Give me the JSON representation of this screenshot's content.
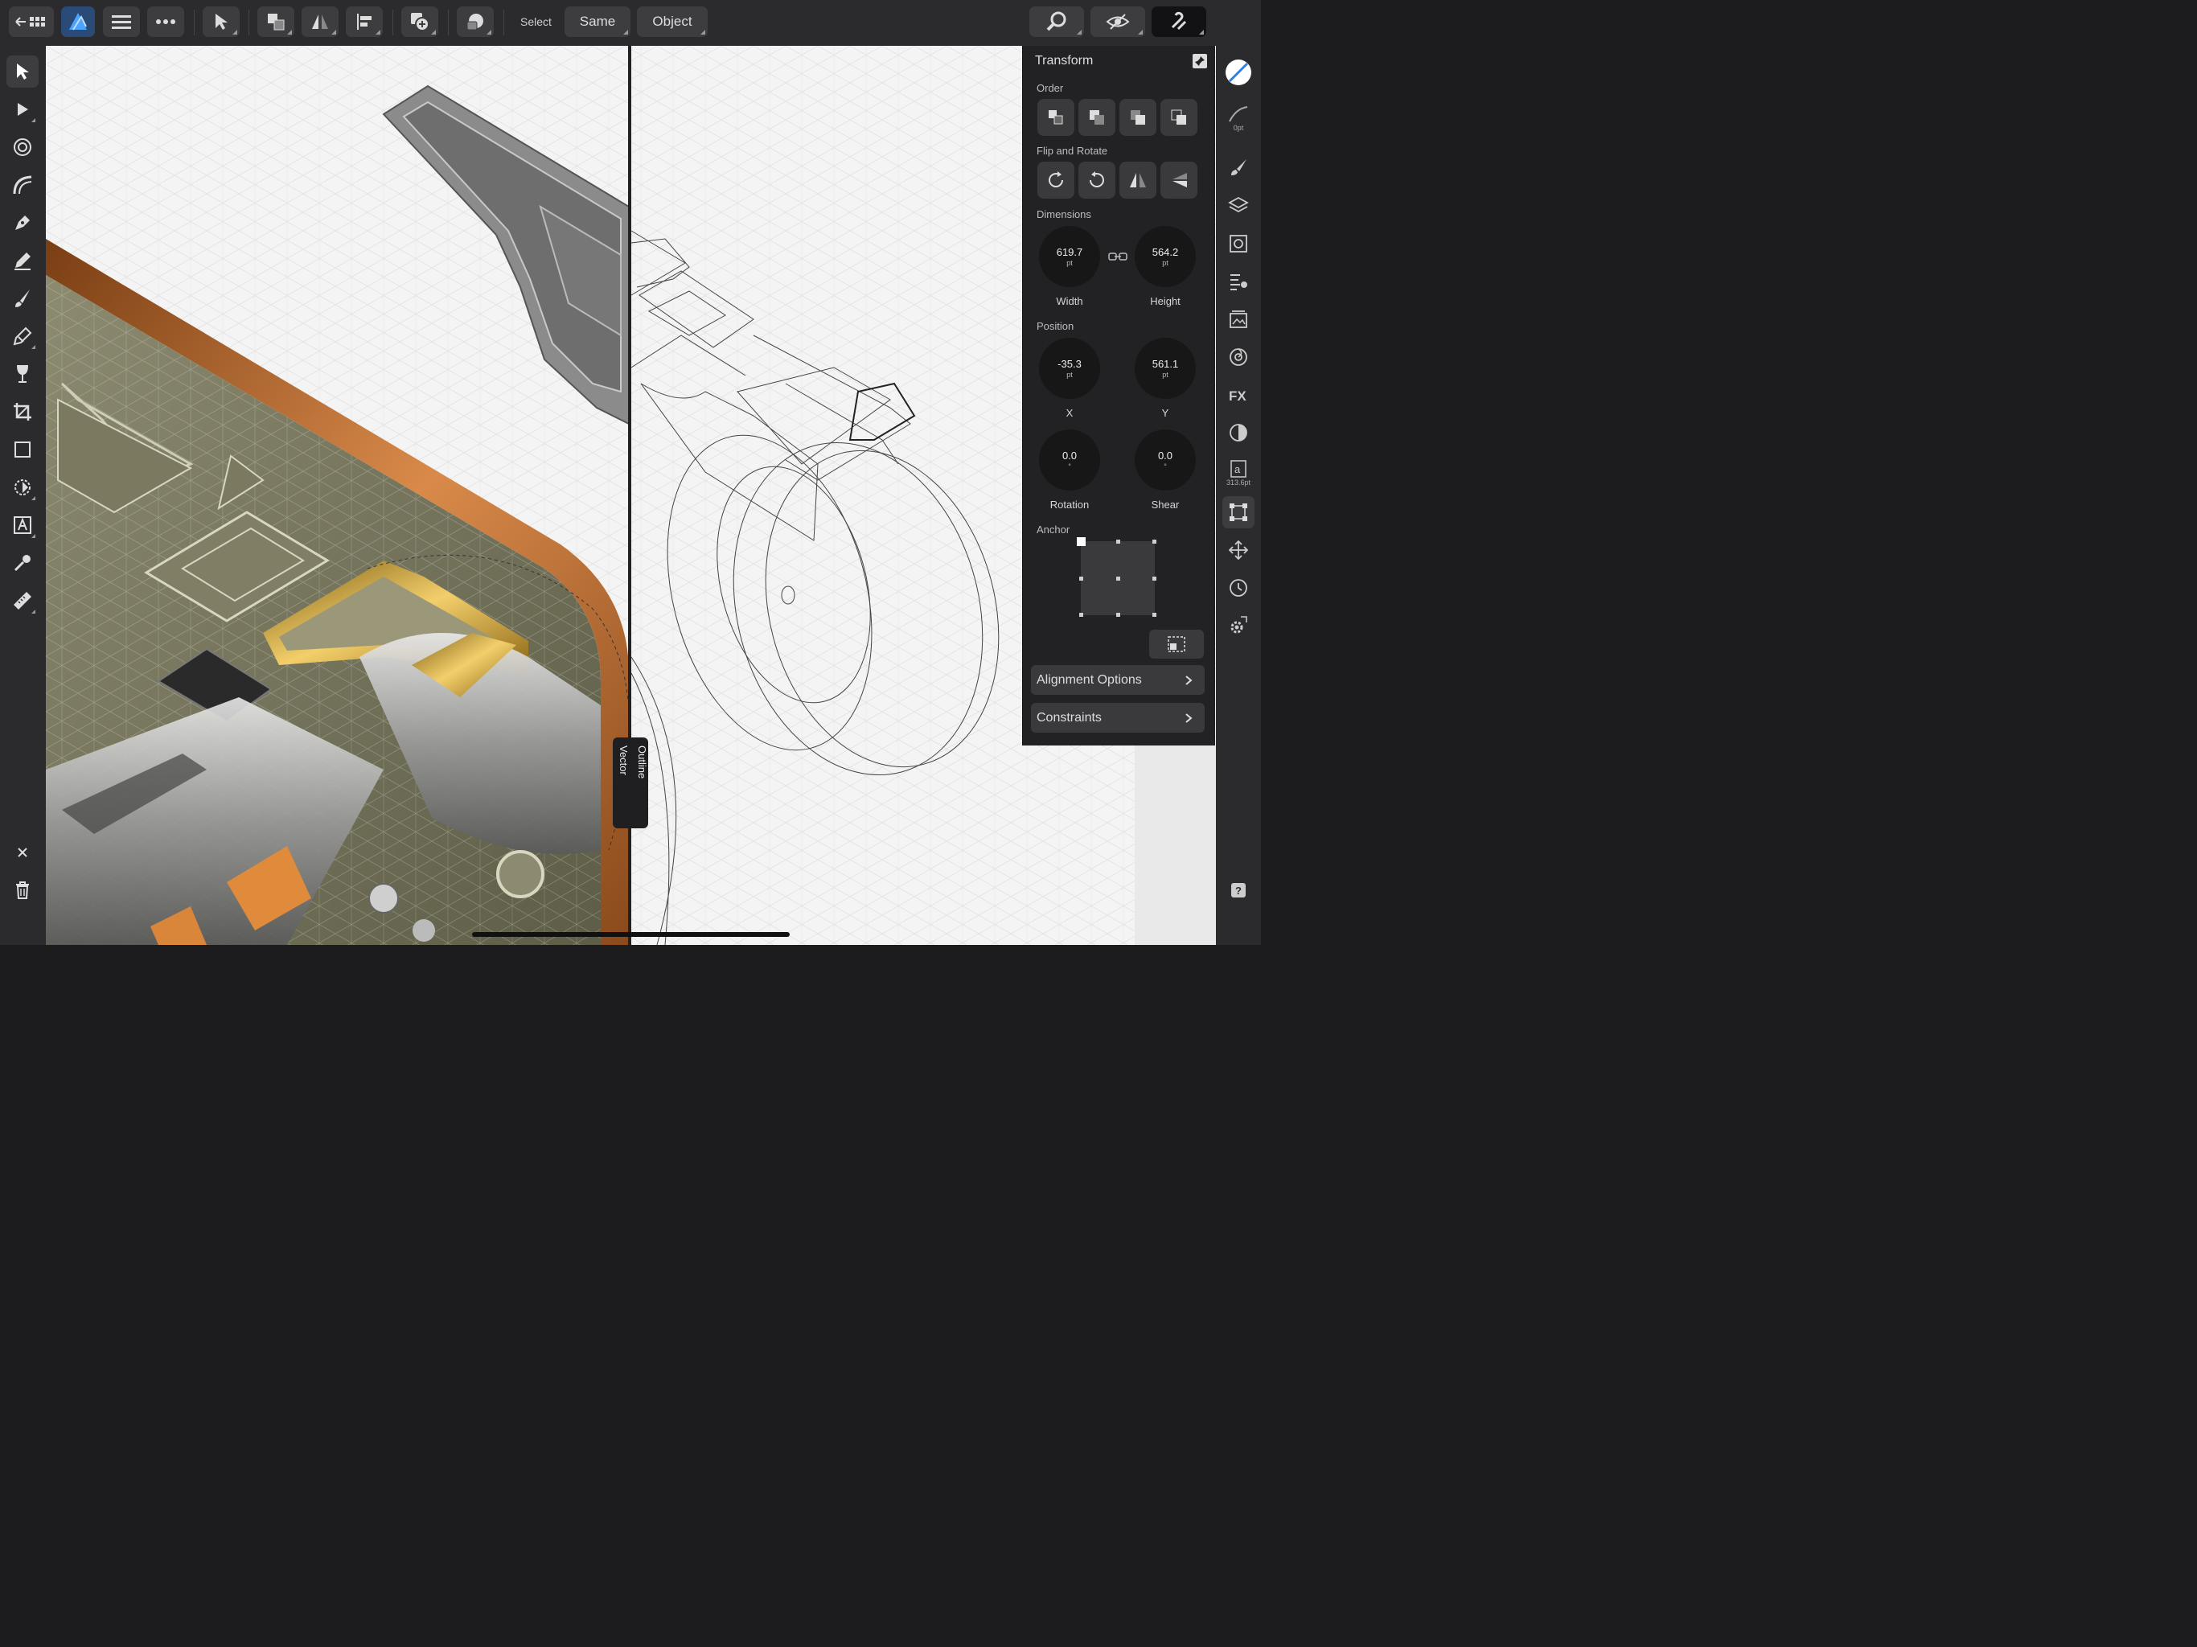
{
  "toolbar": {
    "select_label": "Select",
    "same_label": "Same",
    "object_label": "Object"
  },
  "transform": {
    "title": "Transform",
    "order_label": "Order",
    "flip_rotate_label": "Flip and Rotate",
    "dimensions_label": "Dimensions",
    "width_value": "619.7",
    "width_unit": "pt",
    "width_label": "Width",
    "height_value": "564.2",
    "height_unit": "pt",
    "height_label": "Height",
    "position_label": "Position",
    "x_value": "-35.3",
    "x_unit": "pt",
    "x_label": "X",
    "y_value": "561.1",
    "y_unit": "pt",
    "y_label": "Y",
    "rotation_value": "0.0",
    "rotation_unit": "°",
    "rotation_label": "Rotation",
    "shear_value": "0.0",
    "shear_unit": "°",
    "shear_label": "Shear",
    "anchor_label": "Anchor",
    "alignment_options": "Alignment Options",
    "constraints": "Constraints"
  },
  "right_strip": {
    "stroke_width": "0pt",
    "font_size": "313.6pt"
  },
  "split_view": {
    "left_mode": "Vector",
    "right_mode": "Outline"
  },
  "colors": {
    "accent": "#2f7fe0",
    "chrome": "#2b2b2d",
    "panel": "#222224"
  }
}
